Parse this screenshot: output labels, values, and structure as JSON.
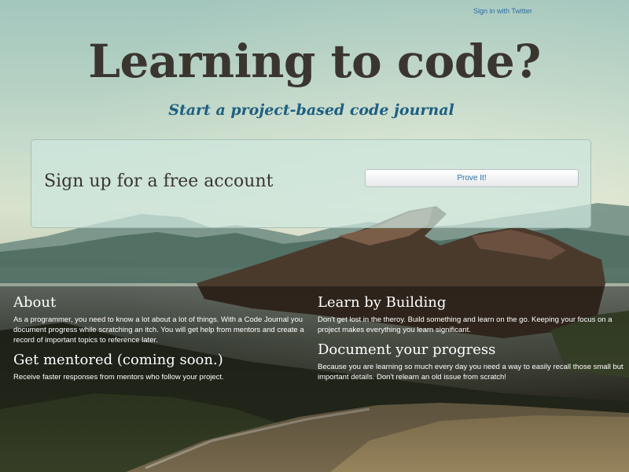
{
  "header": {
    "signin_link": "Sign in with Twitter"
  },
  "hero": {
    "title": "Learning to code?",
    "subtitle": "Start a project-based code journal"
  },
  "signup": {
    "text": "Sign up for a free account",
    "button_label": "Prove It!"
  },
  "features": {
    "left": [
      {
        "heading": "About",
        "body": "As a programmer, you need to know a lot about a lot of things. With a Code Journal you document progress while scratching an itch. You will get help from mentors and create a record of important topics to reference later."
      },
      {
        "heading": "Get mentored (coming soon.)",
        "body": "Receive faster responses from mentors who follow your project."
      }
    ],
    "right": [
      {
        "heading": "Learn by Building",
        "body": "Don't get lost in the theroy. Build something and learn on the go. Keeping your focus on a project makes everything you learn significant."
      },
      {
        "heading": "Document your progress",
        "body": "Because you are learning so much every day you need a way to easily recall those small but important details. Don't relearn an old issue from scratch!"
      }
    ]
  },
  "colors": {
    "title": "#3b3530",
    "subtitle": "#1d5f82",
    "link": "#2d6fa7"
  }
}
